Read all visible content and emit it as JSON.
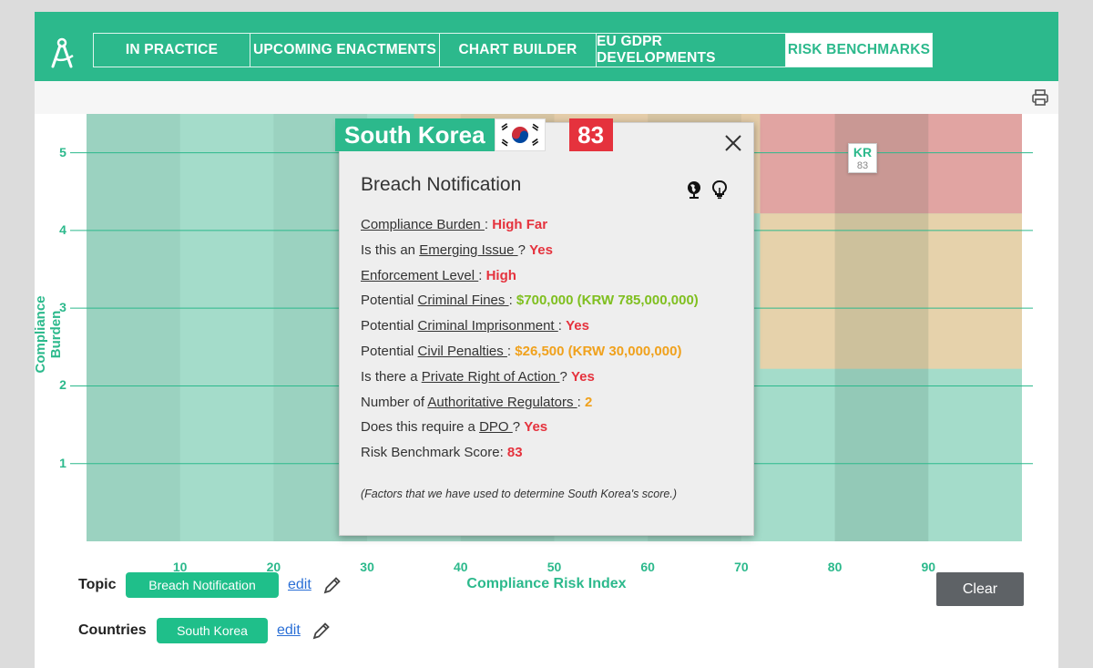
{
  "nav": {
    "tabs": [
      {
        "label": "IN PRACTICE"
      },
      {
        "label": "UPCOMING ENACTMENTS"
      },
      {
        "label": "CHART BUILDER"
      },
      {
        "label": "EU GDPR DEVELOPMENTS"
      },
      {
        "label": "RISK BENCHMARKS"
      }
    ],
    "active_tab": "RISK BENCHMARKS"
  },
  "icons": {
    "logo": "compass-logo-icon",
    "print": "printer-icon",
    "close": "close-icon",
    "globe": "globe-icon",
    "idea": "lightbulb-icon",
    "edit": "pencil-icon"
  },
  "colors": {
    "brand": "#2cb98c",
    "high": "#e5323d",
    "medium": "#f0a11c",
    "low": "#7fbf1f",
    "button": "#5e6266"
  },
  "chart_data": {
    "type": "scatter",
    "xlabel": "Compliance Risk Index",
    "ylabel": "Compliance Burden",
    "xlim": [
      0,
      100
    ],
    "ylim": [
      0,
      5.5
    ],
    "x_ticks": [
      "10",
      "20",
      "30",
      "40",
      "50",
      "60",
      "70",
      "80",
      "90"
    ],
    "y_ticks": [
      "1",
      "2",
      "3",
      "4",
      "5"
    ],
    "grid": true,
    "points": [
      {
        "label": "KR",
        "score": "83",
        "x": 83,
        "y": 5
      }
    ]
  },
  "popup": {
    "country": "South Korea",
    "score": "83",
    "title": "Breach Notification",
    "facts": [
      {
        "prefix": "",
        "link": "Compliance Burden ",
        "sep": ": ",
        "value": "High Far",
        "level": "red"
      },
      {
        "prefix": "Is this an ",
        "link": "Emerging Issue ",
        "sep": "? ",
        "value": "Yes",
        "level": "red"
      },
      {
        "prefix": "",
        "link": "Enforcement Level ",
        "sep": ": ",
        "value": "High",
        "level": "red"
      },
      {
        "prefix": "Potential ",
        "link": "Criminal Fines ",
        "sep": ": ",
        "value": "$700,000 (KRW 785,000,000)",
        "level": "green"
      },
      {
        "prefix": "Potential ",
        "link": "Criminal Imprisonment ",
        "sep": ": ",
        "value": "Yes",
        "level": "red"
      },
      {
        "prefix": "Potential ",
        "link": "Civil Penalties ",
        "sep": ": ",
        "value": "$26,500 (KRW 30,000,000)",
        "level": "orange"
      },
      {
        "prefix": "Is there a ",
        "link": "Private Right of Action ",
        "sep": "? ",
        "value": "Yes",
        "level": "red"
      },
      {
        "prefix": "Number of ",
        "link": "Authoritative Regulators ",
        "sep": ": ",
        "value": "2",
        "level": "orange"
      },
      {
        "prefix": "Does this require a ",
        "link": "DPO ",
        "sep": "? ",
        "value": "Yes",
        "level": "red"
      },
      {
        "prefix": "Risk Benchmark Score",
        "link": "",
        "sep": ": ",
        "value": "83",
        "level": "red"
      }
    ],
    "note": "(Factors that we have used to determine South Korea's score.)"
  },
  "filters": {
    "topic": {
      "label": "Topic",
      "value": "Breach Notification",
      "edit": "edit"
    },
    "countries": {
      "label": "Countries",
      "value": "South Korea",
      "edit": "edit"
    }
  },
  "clear_label": "Clear"
}
